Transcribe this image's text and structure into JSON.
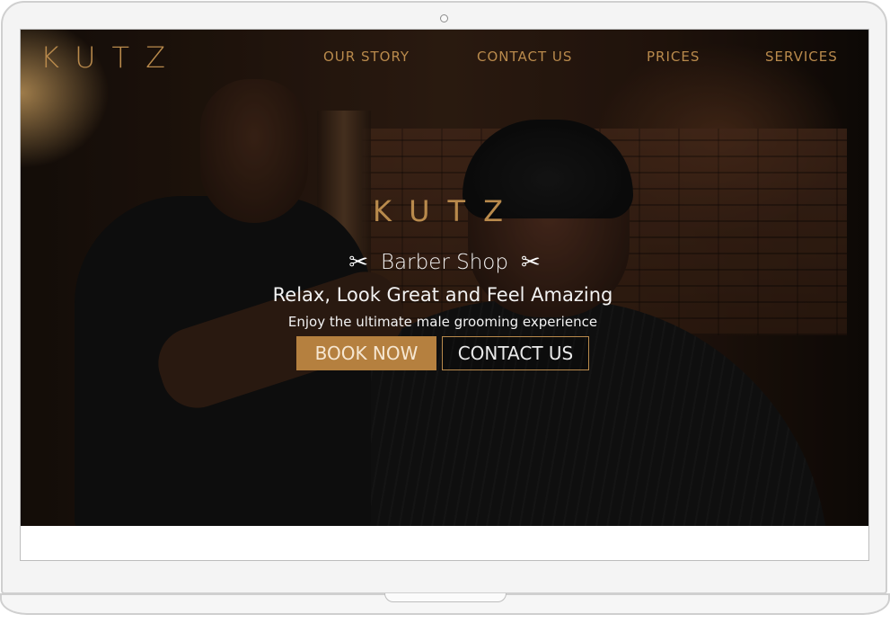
{
  "nav": {
    "logo": "KUTZ",
    "links": [
      "OUR STORY",
      "CONTACT US",
      "PRICES",
      "SERVICES"
    ]
  },
  "hero": {
    "logo": "KUTZ",
    "shop_title": "Barber Shop",
    "scissors_glyph": "✂",
    "tagline": "Relax, Look Great and Feel Amazing",
    "subline": "Enjoy the ultimate male grooming experience",
    "book_button": "BOOK NOW",
    "contact_button": "CONTACT US"
  },
  "colors": {
    "accent": "#b98a4c",
    "button_fill": "#b5803f"
  }
}
